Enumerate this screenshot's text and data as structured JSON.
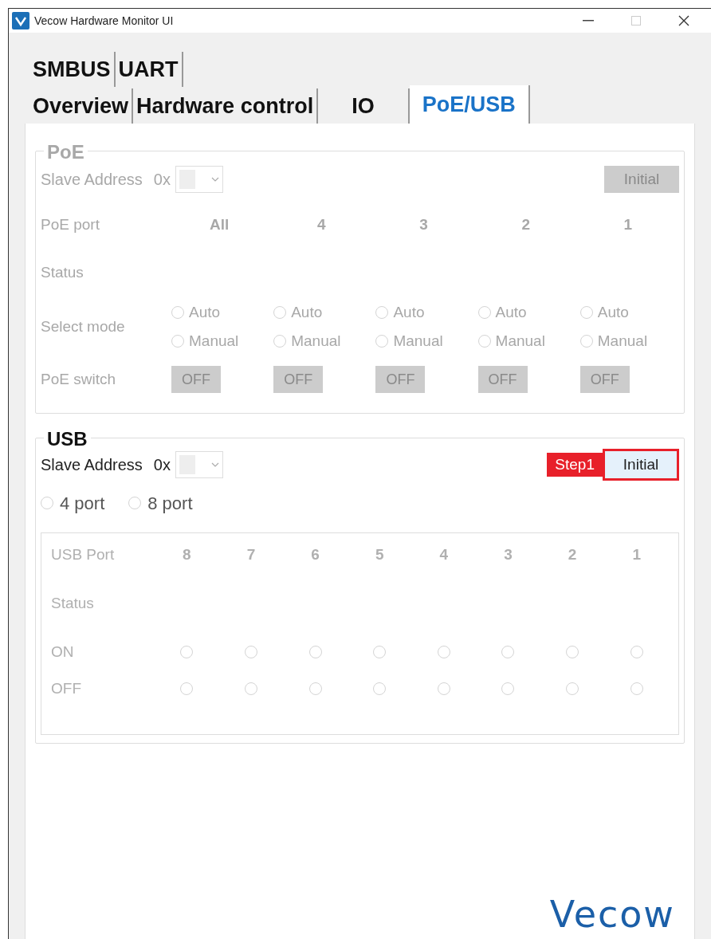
{
  "window": {
    "title": "Vecow Hardware Monitor UI"
  },
  "tab_rows": [
    [
      {
        "label": "SMBUS",
        "selected": false
      },
      {
        "label": "UART",
        "selected": false
      }
    ],
    [
      {
        "label": "Overview",
        "selected": false
      },
      {
        "label": "Hardware control",
        "selected": false
      },
      {
        "label": "IO",
        "selected": false
      },
      {
        "label": "PoE/USB",
        "selected": true
      }
    ]
  ],
  "poe": {
    "title": "PoE",
    "disabled": true,
    "slave_label": "Slave Address",
    "prefix": "0x",
    "button": "Initial",
    "row_labels": [
      "PoE port",
      "Status",
      "Select mode",
      "PoE switch"
    ],
    "ports": [
      {
        "label": "All",
        "modes": [
          {
            "label": "Auto",
            "checked": false
          },
          {
            "label": "Manual",
            "checked": false
          }
        ],
        "switch": "OFF"
      },
      {
        "label": "4",
        "modes": [
          {
            "label": "Auto",
            "checked": false
          },
          {
            "label": "Manual",
            "checked": false
          }
        ],
        "switch": "OFF"
      },
      {
        "label": "3",
        "modes": [
          {
            "label": "Auto",
            "checked": false
          },
          {
            "label": "Manual",
            "checked": false
          }
        ],
        "switch": "OFF"
      },
      {
        "label": "2",
        "modes": [
          {
            "label": "Auto",
            "checked": false
          },
          {
            "label": "Manual",
            "checked": false
          }
        ],
        "switch": "OFF"
      },
      {
        "label": "1",
        "modes": [
          {
            "label": "Auto",
            "checked": false
          },
          {
            "label": "Manual",
            "checked": false
          }
        ],
        "switch": "OFF"
      }
    ]
  },
  "usb": {
    "title": "USB",
    "disabled": false,
    "slave_label": "Slave Address",
    "prefix": "0x",
    "button": "Initial",
    "callout": "Step1",
    "port_options": [
      {
        "label": "4 port",
        "checked": false
      },
      {
        "label": "8 port",
        "checked": false
      }
    ],
    "table": {
      "disabled": true,
      "row_labels": [
        "USB Port",
        "Status",
        "ON",
        "OFF"
      ],
      "ports": [
        {
          "label": "8",
          "on": false,
          "off": false
        },
        {
          "label": "7",
          "on": false,
          "off": false
        },
        {
          "label": "6",
          "on": false,
          "off": false
        },
        {
          "label": "5",
          "on": false,
          "off": false
        },
        {
          "label": "4",
          "on": false,
          "off": false
        },
        {
          "label": "3",
          "on": false,
          "off": false
        },
        {
          "label": "2",
          "on": false,
          "off": false
        },
        {
          "label": "1",
          "on": false,
          "off": false
        }
      ]
    }
  },
  "logo": "Vecow"
}
